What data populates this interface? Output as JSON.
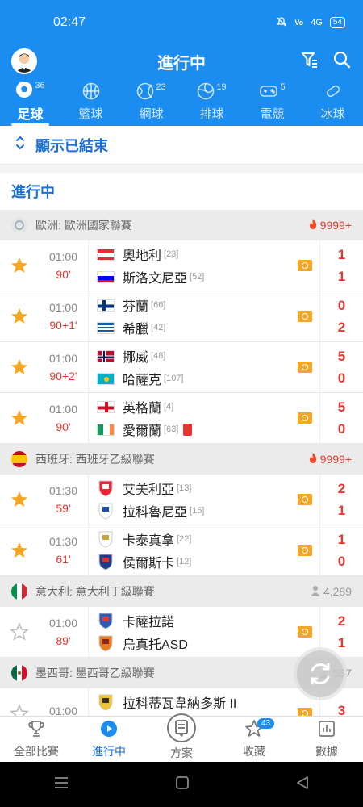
{
  "status_bar": {
    "time": "02:47",
    "signal": "4G",
    "battery": "54"
  },
  "header": {
    "title": "進行中"
  },
  "sport_tabs": [
    {
      "label": "足球",
      "count": "36",
      "icon": "football-icon"
    },
    {
      "label": "籃球",
      "count": "",
      "icon": "basketball-icon"
    },
    {
      "label": "網球",
      "count": "23",
      "icon": "tennis-icon"
    },
    {
      "label": "排球",
      "count": "19",
      "icon": "volleyball-icon"
    },
    {
      "label": "電競",
      "count": "5",
      "icon": "gamepad-icon"
    },
    {
      "label": "冰球",
      "count": "",
      "icon": "hockey-icon"
    }
  ],
  "show_ended": {
    "label": "顯示已結束"
  },
  "section": {
    "title": "進行中"
  },
  "leagues": [
    {
      "name": "歐洲: 歐洲國家聯賽",
      "stat": "9999+",
      "stat_type": "heat",
      "matches": [
        {
          "time": "01:00",
          "minute": "90'",
          "starred": true,
          "home": "奧地利",
          "home_rank": "[23]",
          "away": "斯洛文尼亞",
          "away_rank": "[52]",
          "home_score": "1",
          "away_score": "1"
        },
        {
          "time": "01:00",
          "minute": "90+1'",
          "starred": true,
          "home": "芬蘭",
          "home_rank": "[66]",
          "away": "希臘",
          "away_rank": "[42]",
          "home_score": "0",
          "away_score": "2"
        },
        {
          "time": "01:00",
          "minute": "90+2'",
          "starred": true,
          "home": "挪威",
          "home_rank": "[48]",
          "away": "哈薩克",
          "away_rank": "[107]",
          "home_score": "5",
          "away_score": "0"
        },
        {
          "time": "01:00",
          "minute": "90'",
          "starred": true,
          "home": "英格蘭",
          "home_rank": "[4]",
          "away": "愛爾蘭",
          "away_rank": "[63]",
          "home_score": "5",
          "away_score": "0"
        }
      ]
    },
    {
      "name": "西班牙: 西班牙乙級聯賽",
      "stat": "9999+",
      "stat_type": "heat",
      "matches": [
        {
          "time": "01:30",
          "minute": "59'",
          "starred": true,
          "home": "艾美利亞",
          "home_rank": "[13]",
          "away": "拉科魯尼亞",
          "away_rank": "[15]",
          "home_score": "2",
          "away_score": "1"
        },
        {
          "time": "01:30",
          "minute": "61'",
          "starred": true,
          "home": "卡泰真拿",
          "home_rank": "[22]",
          "away": "侯爾斯卡",
          "away_rank": "[12]",
          "home_score": "1",
          "away_score": "0"
        }
      ]
    },
    {
      "name": "意大利: 意大利丁級聯賽",
      "stat": "4,289",
      "stat_type": "people",
      "matches": [
        {
          "time": "01:00",
          "minute": "89'",
          "starred": false,
          "home": "卡薩拉諾",
          "home_rank": "",
          "away": "烏真托ASD",
          "away_rank": "",
          "home_score": "2",
          "away_score": "1"
        }
      ]
    },
    {
      "name": "墨西哥: 墨西哥乙級聯賽",
      "stat": "557",
      "stat_type": "people",
      "matches": [
        {
          "time": "01:00",
          "minute": "",
          "starred": false,
          "home": "拉科蒂瓦韋納多斯 II",
          "home_rank": "",
          "away": "",
          "away_rank": "",
          "home_score": "3",
          "away_score": ""
        }
      ]
    }
  ],
  "bottom_nav": [
    {
      "label": "全部比賽",
      "icon": "trophy-icon"
    },
    {
      "label": "進行中",
      "icon": "play-icon"
    },
    {
      "label": "方案",
      "icon": "document-icon"
    },
    {
      "label": "收藏",
      "icon": "star-icon",
      "badge": "43"
    },
    {
      "label": "數據",
      "icon": "chart-icon"
    }
  ],
  "colors": {
    "brand_blue": "#1b8cf0",
    "score_red": "#e8352f",
    "star_orange": "#f5a623"
  }
}
